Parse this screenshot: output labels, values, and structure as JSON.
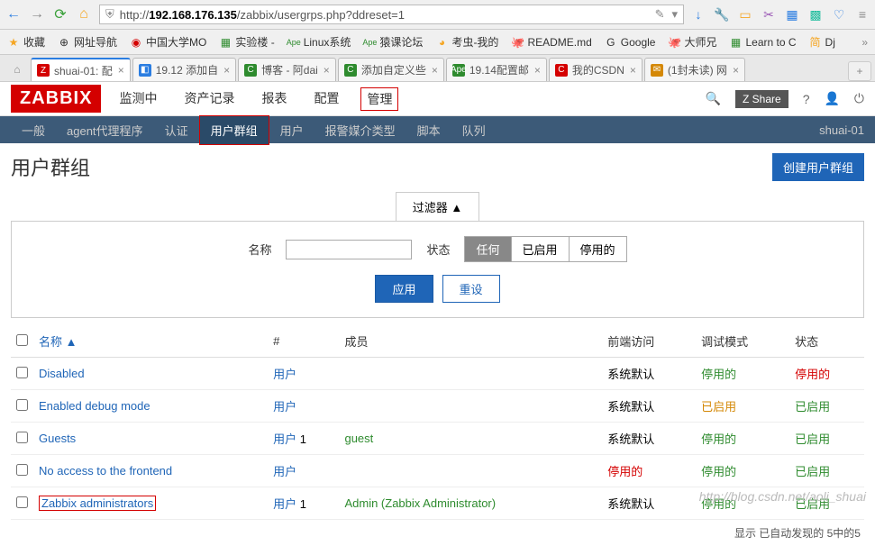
{
  "url": {
    "prefix": "http://",
    "bold": "192.168.176.135",
    "rest": "/zabbix/usergrps.php?ddreset=1"
  },
  "bookmarks": [
    "收藏",
    "网址导航",
    "中国大学MO",
    "实验楼 -",
    "Linux系统",
    "猿课论坛",
    "考虫-我的",
    "README.md",
    "Google",
    "大师兄",
    "Learn to C",
    "Dj"
  ],
  "tabs": [
    {
      "title": "shuai-01: 配",
      "fav": "Z",
      "color": "#d40000",
      "active": true
    },
    {
      "title": "19.12 添加自",
      "fav": "◧",
      "color": "#2a7de1"
    },
    {
      "title": "博客 - 阿dai",
      "fav": "C",
      "color": "#2e8b2e"
    },
    {
      "title": "添加自定义些",
      "fav": "C",
      "color": "#2e8b2e"
    },
    {
      "title": "19.14配置邮",
      "fav": "Ape",
      "color": "#2e8b2e"
    },
    {
      "title": "我的CSDN",
      "fav": "C",
      "color": "#d40000"
    },
    {
      "title": "(1封未读) 网",
      "fav": "✉",
      "color": "#d48806"
    }
  ],
  "zbx": {
    "logo": "ZABBIX",
    "nav": [
      "监测中",
      "资产记录",
      "报表",
      "配置",
      "管理"
    ],
    "nav_active": "管理",
    "share": "Z Share",
    "user_top": "shuai-01"
  },
  "subnav": {
    "items": [
      "一般",
      "agent代理程序",
      "认证",
      "用户群组",
      "用户",
      "报警媒介类型",
      "脚本",
      "队列"
    ],
    "active": "用户群组"
  },
  "page": {
    "title": "用户群组",
    "create_btn": "创建用户群组",
    "filter_tab": "过滤器 ▲",
    "name_label": "名称",
    "status_label": "状态",
    "status_opts": [
      "任何",
      "已启用",
      "停用的"
    ],
    "status_active": "任何",
    "apply": "应用",
    "reset": "重设"
  },
  "table": {
    "headers": {
      "name": "名称 ▲",
      "count": "#",
      "members": "成员",
      "frontend": "前端访问",
      "debug": "调试模式",
      "status": "状态"
    },
    "rows": [
      {
        "name": "Disabled",
        "count": "",
        "user": "用户",
        "members": "",
        "frontend": "系统默认",
        "debug": "停用的",
        "debug_cls": "green",
        "status": "停用的",
        "status_cls": "red"
      },
      {
        "name": "Enabled debug mode",
        "count": "",
        "user": "用户",
        "members": "",
        "frontend": "系统默认",
        "debug": "已启用",
        "debug_cls": "orange",
        "status": "已启用",
        "status_cls": "green"
      },
      {
        "name": "Guests",
        "count": "1",
        "user": "用户",
        "members": "guest",
        "frontend": "系统默认",
        "debug": "停用的",
        "debug_cls": "green",
        "status": "已启用",
        "status_cls": "green"
      },
      {
        "name": "No access to the frontend",
        "count": "",
        "user": "用户",
        "members": "",
        "frontend": "停用的",
        "frontend_cls": "red",
        "debug": "停用的",
        "debug_cls": "green",
        "status": "已启用",
        "status_cls": "green"
      },
      {
        "name": "Zabbix administrators",
        "count": "1",
        "user": "用户",
        "members": "Admin (Zabbix Administrator)",
        "frontend": "系统默认",
        "debug": "停用的",
        "debug_cls": "green",
        "status": "已启用",
        "status_cls": "green",
        "boxed": true
      }
    ],
    "footer": "显示 已自动发现的 5中的5"
  },
  "watermark": "http://blog.csdn.net/aoli_shuai"
}
